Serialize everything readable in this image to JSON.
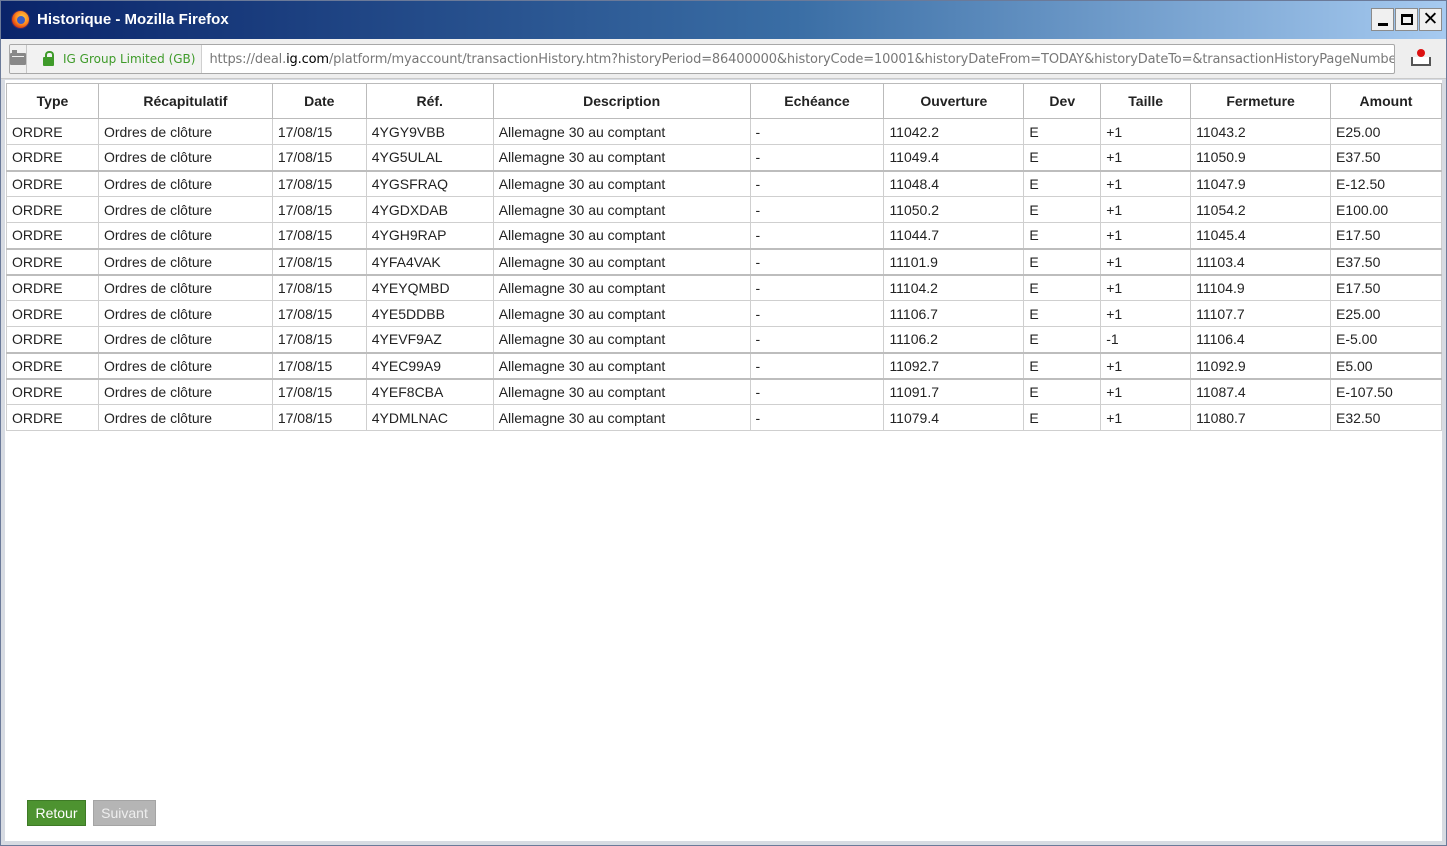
{
  "window": {
    "title": "Historique - Mozilla Firefox"
  },
  "urlbar": {
    "identity": "IG Group Limited (GB)",
    "url_prefix": "https://deal.",
    "url_domain": "ig.com",
    "url_rest": "/platform/myaccount/transactionHistory.htm?historyPeriod=86400000&historyCode=10001&historyDateFrom=TODAY&historyDateTo=&transactionHistoryPageNumber="
  },
  "table": {
    "headers": [
      "Type",
      "Récapitulatif",
      "Date",
      "Réf.",
      "Description",
      "Echéance",
      "Ouverture",
      "Dev",
      "Taille",
      "Fermeture",
      "Amount"
    ],
    "rows": [
      [
        "ORDRE",
        "Ordres de clôture",
        "17/08/15",
        "4YGY9VBB",
        "Allemagne 30 au comptant",
        "-",
        "11042.2",
        "E",
        "+1",
        "11043.2",
        "E25.00"
      ],
      [
        "ORDRE",
        "Ordres de clôture",
        "17/08/15",
        "4YG5ULAL",
        "Allemagne 30 au comptant",
        "-",
        "11049.4",
        "E",
        "+1",
        "11050.9",
        "E37.50"
      ],
      [
        "ORDRE",
        "Ordres de clôture",
        "17/08/15",
        "4YGSFRAQ",
        "Allemagne 30 au comptant",
        "-",
        "11048.4",
        "E",
        "+1",
        "11047.9",
        "E-12.50"
      ],
      [
        "ORDRE",
        "Ordres de clôture",
        "17/08/15",
        "4YGDXDAB",
        "Allemagne 30 au comptant",
        "-",
        "11050.2",
        "E",
        "+1",
        "11054.2",
        "E100.00"
      ],
      [
        "ORDRE",
        "Ordres de clôture",
        "17/08/15",
        "4YGH9RAP",
        "Allemagne 30 au comptant",
        "-",
        "11044.7",
        "E",
        "+1",
        "11045.4",
        "E17.50"
      ],
      [
        "ORDRE",
        "Ordres de clôture",
        "17/08/15",
        "4YFA4VAK",
        "Allemagne 30 au comptant",
        "-",
        "11101.9",
        "E",
        "+1",
        "11103.4",
        "E37.50"
      ],
      [
        "ORDRE",
        "Ordres de clôture",
        "17/08/15",
        "4YEYQMBD",
        "Allemagne 30 au comptant",
        "-",
        "11104.2",
        "E",
        "+1",
        "11104.9",
        "E17.50"
      ],
      [
        "ORDRE",
        "Ordres de clôture",
        "17/08/15",
        "4YE5DDBB",
        "Allemagne 30 au comptant",
        "-",
        "11106.7",
        "E",
        "+1",
        "11107.7",
        "E25.00"
      ],
      [
        "ORDRE",
        "Ordres de clôture",
        "17/08/15",
        "4YEVF9AZ",
        "Allemagne 30 au comptant",
        "-",
        "11106.2",
        "E",
        "-1",
        "11106.4",
        "E-5.00"
      ],
      [
        "ORDRE",
        "Ordres de clôture",
        "17/08/15",
        "4YEC99A9",
        "Allemagne 30 au comptant",
        "-",
        "11092.7",
        "E",
        "+1",
        "11092.9",
        "E5.00"
      ],
      [
        "ORDRE",
        "Ordres de clôture",
        "17/08/15",
        "4YEF8CBA",
        "Allemagne 30 au comptant",
        "-",
        "11091.7",
        "E",
        "+1",
        "11087.4",
        "E-107.50"
      ],
      [
        "ORDRE",
        "Ordres de clôture",
        "17/08/15",
        "4YDMLNAC",
        "Allemagne 30 au comptant",
        "-",
        "11079.4",
        "E",
        "+1",
        "11080.7",
        "E32.50"
      ]
    ]
  },
  "buttons": {
    "back": "Retour",
    "next": "Suivant"
  },
  "icons": {
    "browser_logo": "firefox-icon",
    "page": "page-icon",
    "secure": "lock-icon",
    "addon": "download-tray-icon"
  },
  "colors": {
    "secure_green": "#3f9b2a",
    "back_button": "#4d9330",
    "next_button_disabled": "#b5b5b5"
  }
}
